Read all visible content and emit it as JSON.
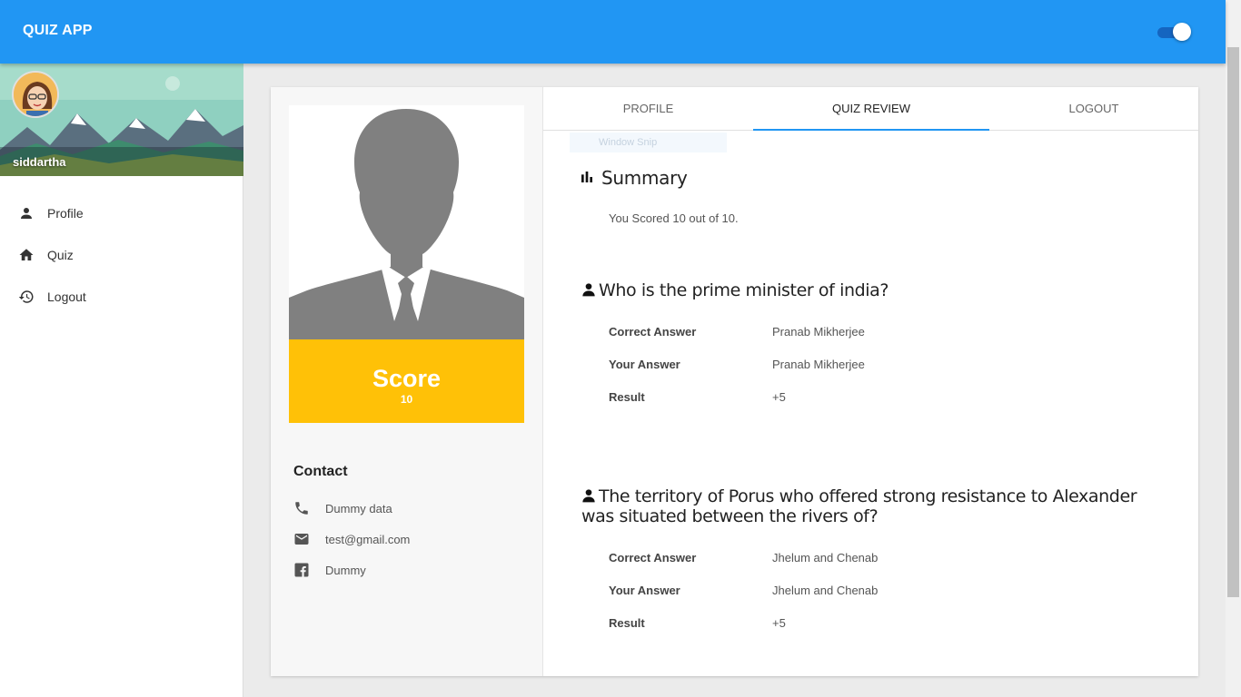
{
  "app": {
    "title": "QUIZ APP",
    "theme_toggle_on": true
  },
  "sidebar": {
    "username": "siddartha",
    "items": [
      {
        "label": "Profile",
        "icon": "person-icon"
      },
      {
        "label": "Quiz",
        "icon": "home-icon"
      },
      {
        "label": "Logout",
        "icon": "history-icon"
      }
    ]
  },
  "profile": {
    "score_label": "Score",
    "score_value": "10",
    "contact_title": "Contact",
    "contacts": [
      {
        "icon": "phone-icon",
        "text": "Dummy data"
      },
      {
        "icon": "email-icon",
        "text": "test@gmail.com"
      },
      {
        "icon": "facebook-icon",
        "text": "Dummy"
      }
    ]
  },
  "tabs": [
    {
      "label": "PROFILE",
      "active": false
    },
    {
      "label": "QUIZ REVIEW",
      "active": true
    },
    {
      "label": "LOGOUT",
      "active": false
    }
  ],
  "overlay": {
    "snip_text": "Window Snip"
  },
  "review": {
    "summary_title": "Summary",
    "summary_text": "You Scored 10 out of 10.",
    "field_labels": {
      "correct": "Correct Answer",
      "yours": "Your Answer",
      "result": "Result"
    },
    "questions": [
      {
        "question": "Who is the prime minister of india?",
        "correct": "Pranab Mikherjee",
        "yours": "Pranab Mikherjee",
        "result": "+5"
      },
      {
        "question": "The territory of Porus who offered strong resistance to Alexander was situated between the rivers of?",
        "correct": "Jhelum and Chenab",
        "yours": "Jhelum and Chenab",
        "result": "+5"
      }
    ]
  },
  "colors": {
    "primary": "#2196f3",
    "accent": "#ffc107",
    "toggle_track": "#1565c0"
  }
}
